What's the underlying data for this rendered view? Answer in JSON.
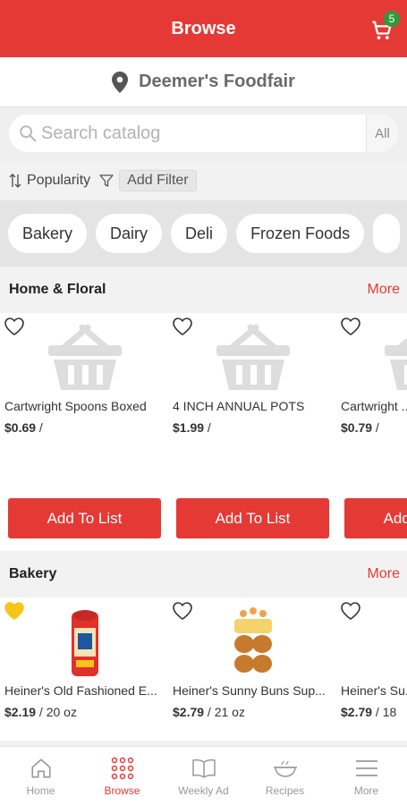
{
  "header": {
    "title": "Browse",
    "cart_count": "5"
  },
  "store": {
    "name": "Deemer's Foodfair"
  },
  "search": {
    "placeholder": "Search catalog",
    "scope": "All"
  },
  "filters": {
    "sort_label": "Popularity",
    "add_filter_label": "Add Filter"
  },
  "categories": [
    "Bakery",
    "Dairy",
    "Deli",
    "Frozen Foods"
  ],
  "sections": [
    {
      "title": "Home & Floral",
      "more": "More",
      "products": [
        {
          "name": "Cartwright Spoons Boxed",
          "price": "$0.69",
          "unit": " / ",
          "button": "Add To List"
        },
        {
          "name": "4 INCH ANNUAL POTS",
          "price": "$1.99",
          "unit": " / ",
          "button": "Add To List"
        },
        {
          "name": "Cartwright ...",
          "price": "$0.79",
          "unit": " / ",
          "button": "Add To List"
        }
      ]
    },
    {
      "title": "Bakery",
      "more": "More",
      "products": [
        {
          "name": "Heiner's Old Fashioned E...",
          "price": "$2.19",
          "unit": " / 20 oz",
          "favorited": true
        },
        {
          "name": "Heiner's Sunny Buns Sup...",
          "price": "$2.79",
          "unit": " / 21 oz"
        },
        {
          "name": "Heiner's Su...",
          "price": "$2.79",
          "unit": " / 18"
        }
      ]
    }
  ],
  "nav": [
    {
      "label": "Home",
      "icon": "home-icon"
    },
    {
      "label": "Browse",
      "icon": "grid-icon",
      "active": true
    },
    {
      "label": "Weekly Ad",
      "icon": "book-icon"
    },
    {
      "label": "Recipes",
      "icon": "recipe-icon"
    },
    {
      "label": "More",
      "icon": "menu-icon"
    }
  ],
  "colors": {
    "brand": "#e53935",
    "badge": "#2e9b3a",
    "favorite": "#f5c518"
  }
}
